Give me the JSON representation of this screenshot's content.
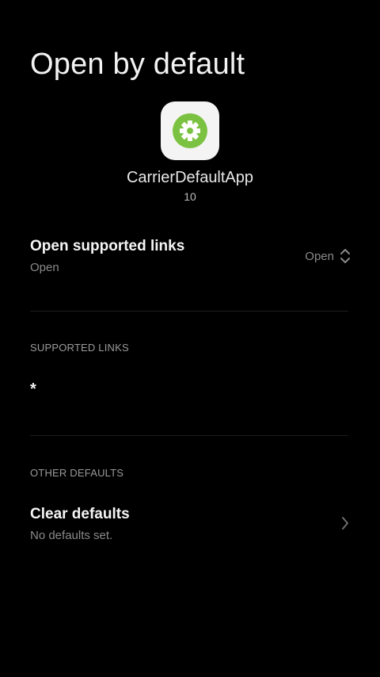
{
  "header": {
    "title": "Open by default"
  },
  "app": {
    "icon": "gear-settings-icon",
    "icon_color": "#7cc242",
    "name": "CarrierDefaultApp",
    "version": "10"
  },
  "open_links": {
    "title": "Open supported links",
    "subtitle": "Open",
    "selected_value": "Open",
    "control_icon": "up-down-arrows-icon"
  },
  "supported_links": {
    "header": "SUPPORTED LINKS",
    "items": [
      "*"
    ]
  },
  "other_defaults": {
    "header": "OTHER DEFAULTS",
    "clear_title": "Clear defaults",
    "clear_subtitle": "No defaults set.",
    "chevron_icon": "chevron-right-icon"
  }
}
